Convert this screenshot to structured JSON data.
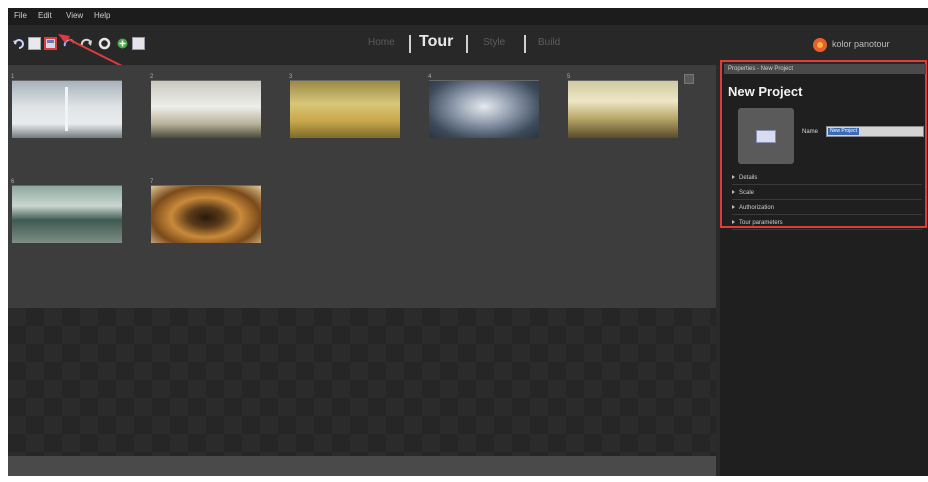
{
  "menu": {
    "file": "File",
    "edit": "Edit",
    "view": "View",
    "help": "Help"
  },
  "modes": {
    "home": "Home",
    "tour": "Tour",
    "style": "Style",
    "build": "Build"
  },
  "brand": {
    "name": "kolor panotour"
  },
  "gallery": {
    "thumbnails": [
      {
        "number": "1"
      },
      {
        "number": "2"
      },
      {
        "number": "3"
      },
      {
        "number": "4"
      },
      {
        "number": "5"
      },
      {
        "number": "6"
      },
      {
        "number": "7"
      }
    ]
  },
  "properties": {
    "header": "Properties - New Project",
    "title": "New Project",
    "name_label": "Name",
    "name_value": "New Project",
    "sections": [
      "Details",
      "Scale",
      "Authorization",
      "Tour parameters"
    ]
  },
  "colors": {
    "annotation": "#e03a3a",
    "background": "#3b3b3b",
    "toolbar": "#282828",
    "panel": "#1f1f1f"
  },
  "icons": [
    "undo-icon",
    "new-file-icon",
    "save-icon",
    "redo-back-icon",
    "redo-icon",
    "settings-icon",
    "add-icon",
    "folder-icon",
    "kolor-logo-icon",
    "expand-icon"
  ]
}
